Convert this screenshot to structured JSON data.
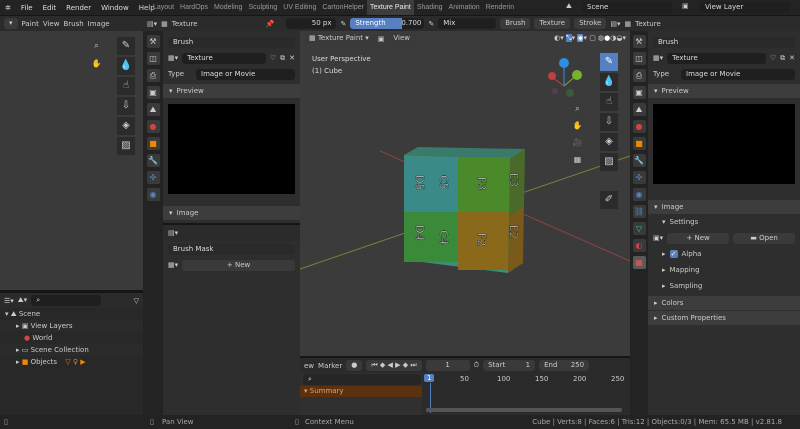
{
  "menu": [
    "File",
    "Edit",
    "Render",
    "Window",
    "Help"
  ],
  "workspaces": [
    "Layout",
    "HardOps",
    "Modeling",
    "Sculpting",
    "UV Editing",
    "CartonHelper",
    "Texture Paint",
    "Shading",
    "Animation",
    "Renderin"
  ],
  "active_workspace": "Texture Paint",
  "scene": "Scene",
  "view_layer": "View Layer",
  "image_editor": {
    "mode": "Paint",
    "menus": [
      "View",
      "Brush",
      "Image"
    ]
  },
  "tool_header": {
    "texture_label": "Texture",
    "radius": "50 px",
    "strength_label": "Strength",
    "strength": "0.700",
    "strength_fraction": 0.7,
    "blend": "Mix",
    "menus": [
      "Brush",
      "Texture",
      "Stroke"
    ],
    "texture_right": "Texture"
  },
  "left_props": {
    "context": "Brush",
    "texture_name": "Texture",
    "type_label": "Type",
    "type_value": "Image or Movie",
    "preview": "Preview",
    "image": "Image",
    "mask_context": "Brush Mask",
    "new_label": "New"
  },
  "viewport": {
    "mode": "Texture Paint",
    "view": "View",
    "perspective": "User Perspective",
    "object": "(1) Cube",
    "cube_labels": [
      "D5",
      "C5",
      "F3",
      "E3",
      "D4",
      "C4",
      "F2",
      "E2"
    ]
  },
  "right_props": {
    "context": "Brush",
    "texture_name": "Texture",
    "type_label": "Type",
    "type_value": "Image or Movie",
    "preview": "Preview",
    "image": "Image",
    "settings": "Settings",
    "new_label": "New",
    "open_label": "Open",
    "alpha": "Alpha",
    "mapping": "Mapping",
    "sampling": "Sampling",
    "colors": "Colors",
    "custom": "Custom Properties"
  },
  "outliner": {
    "scene": "Scene",
    "items": [
      "View Layers",
      "World",
      "Scene Collection",
      "Objects"
    ]
  },
  "timeline": {
    "menus": [
      "ew",
      "Marker"
    ],
    "frame": "1",
    "start_label": "Start",
    "start": "1",
    "end_label": "End",
    "end": "250",
    "ticks": [
      "1",
      "50",
      "100",
      "150",
      "200",
      "250"
    ],
    "summary": "Summary"
  },
  "status": {
    "left": "Pan View",
    "middle": "Context Menu",
    "right": "Cube | Verts:8 | Faces:6 | Tris:12 | Objects:0/3 | Mem: 65.5 MB | v2.81.8"
  }
}
